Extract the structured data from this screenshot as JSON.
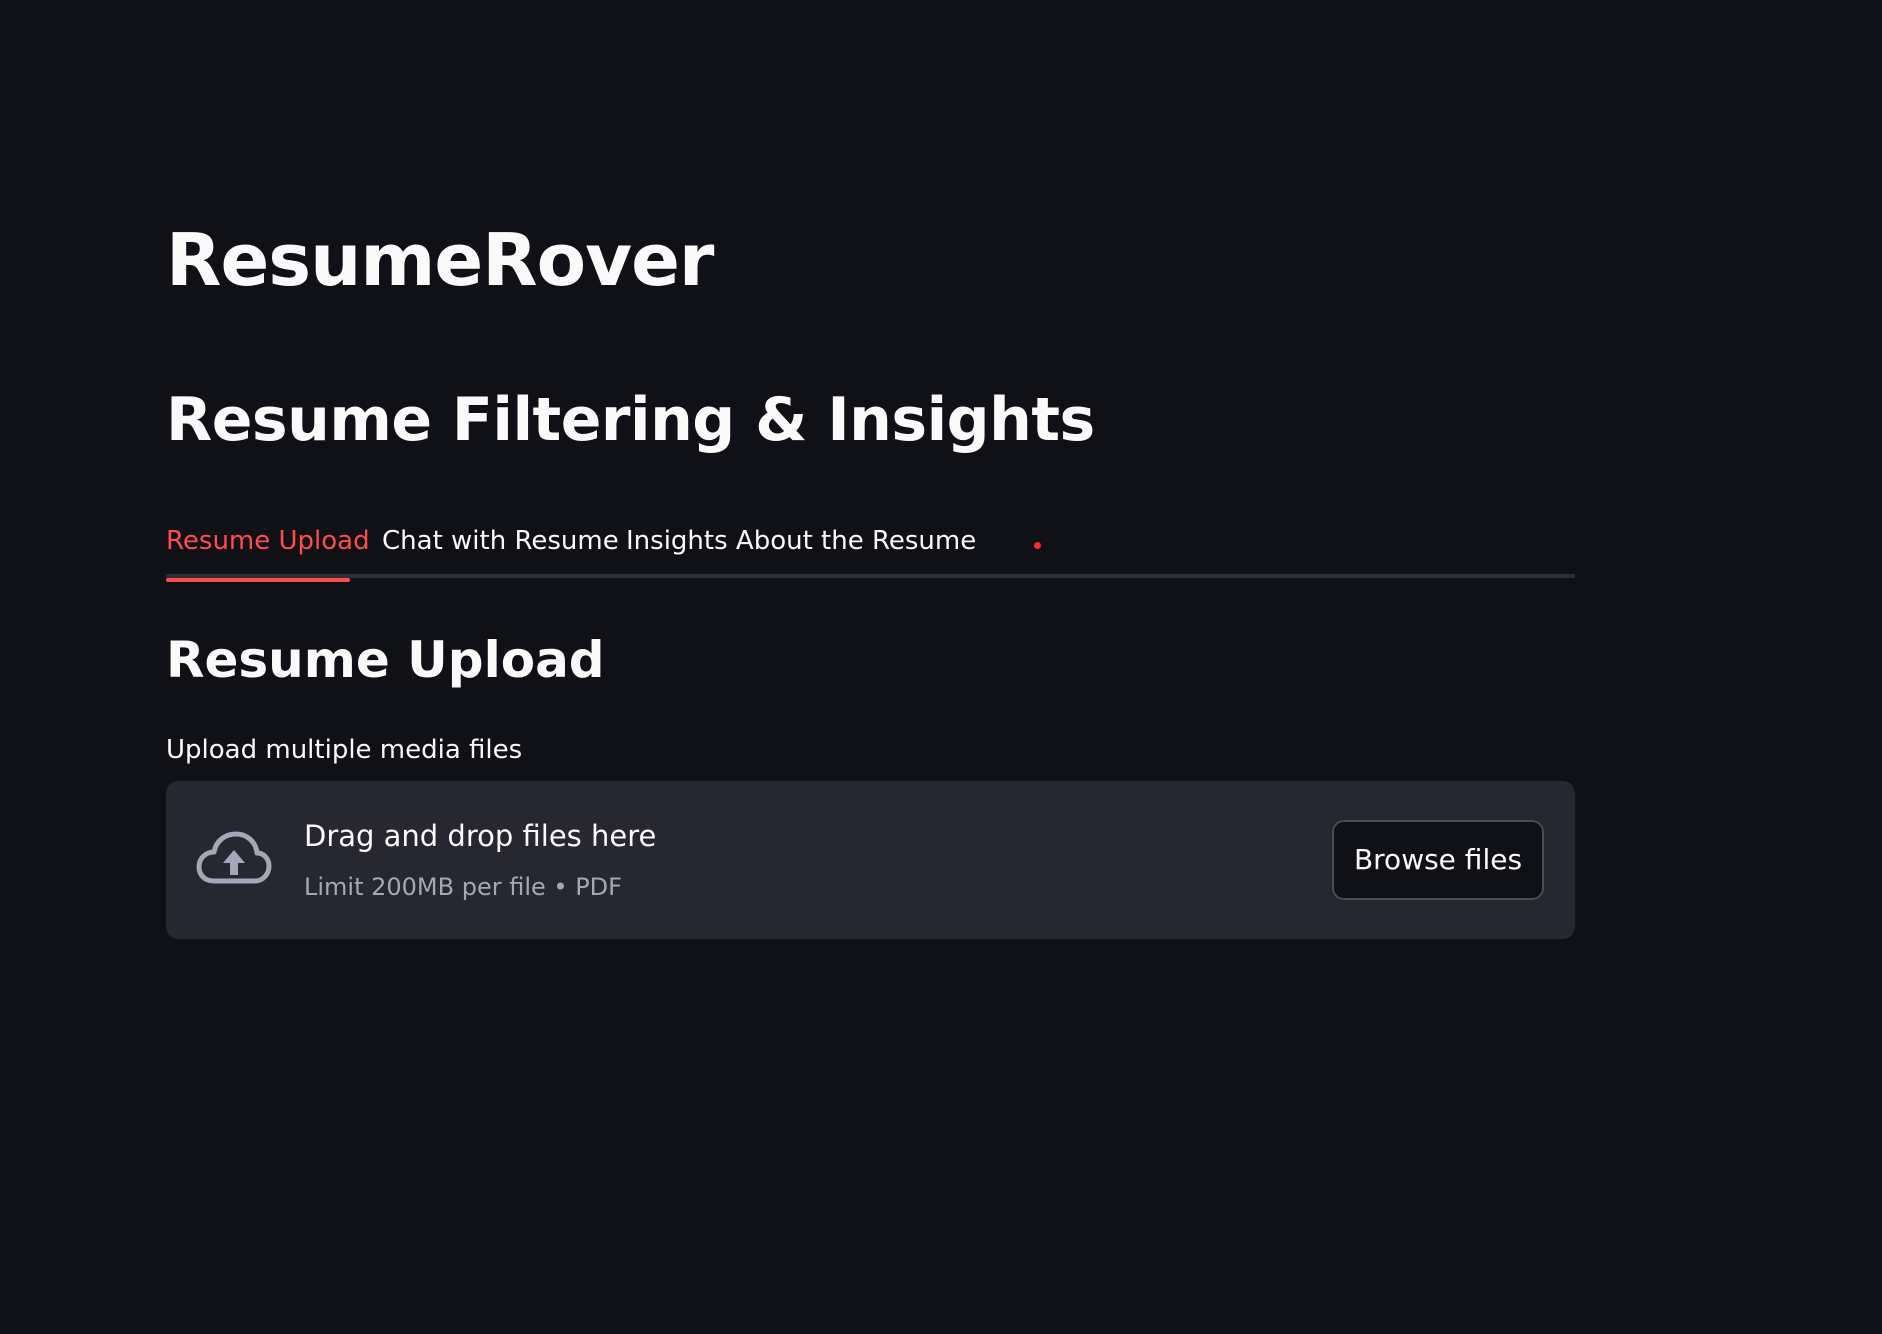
{
  "app": {
    "title": "ResumeRover",
    "subtitle": "Resume Filtering & Insights"
  },
  "tabs": [
    {
      "label": "Resume Upload",
      "active": true
    },
    {
      "label": "Chat with Resume",
      "active": false
    },
    {
      "label": "Insights About the Resume",
      "active": false
    }
  ],
  "section": {
    "heading": "Resume Upload"
  },
  "uploader": {
    "label": "Upload multiple media files",
    "drop_text": "Drag and drop files here",
    "limit_text": "Limit 200MB per file • PDF",
    "button_label": "Browse files",
    "icon": "cloud-upload-icon"
  },
  "colors": {
    "background": "#0f1117",
    "accent": "#ff4b4b",
    "dropzone": "#262730",
    "text": "#fafafa",
    "muted_text": "#a3a8b8"
  }
}
